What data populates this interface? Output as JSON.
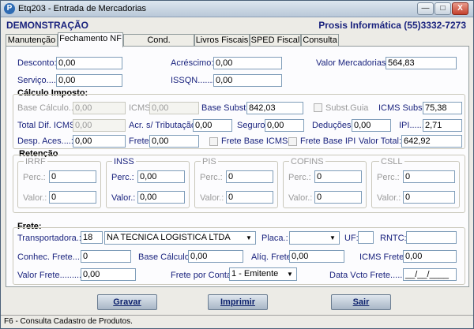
{
  "window": {
    "title": "Etq203 - Entrada de Mercadorias",
    "app_icon_letter": "P",
    "minimize_glyph": "—",
    "maximize_glyph": "□",
    "close_glyph": "X"
  },
  "header": {
    "left": "DEMONSTRAÇÃO",
    "right": "Prosis Informática (55)3332-7273"
  },
  "tabs": [
    {
      "label": "Manutenção"
    },
    {
      "label": "Fechamento NF",
      "active": true
    },
    {
      "label": "Cond. Pagamento"
    },
    {
      "label": "Livros Fiscais"
    },
    {
      "label": "SPED Fiscal"
    },
    {
      "label": "Consulta"
    }
  ],
  "top": {
    "desconto_label": "Desconto:",
    "desconto": "0,00",
    "acrescimo_label": "Acréscimo:",
    "acrescimo": "0,00",
    "valor_merc_label": "Valor Mercadorias:",
    "valor_merc": "564,83",
    "servico_label": "Serviço....:",
    "servico": "0,00",
    "issqn_label": "ISSQN........:",
    "issqn": "0,00"
  },
  "imposto": {
    "title": "Cálculo Imposto:",
    "base_calculo_label": "Base Cálculo....:",
    "base_calculo": "0,00",
    "icms_label": "ICMS:",
    "icms": "0,00",
    "base_subst_label": "Base Subst.",
    "base_subst": "842,03",
    "subst_guia_label": "Subst.Guia",
    "icms_subst_label": "ICMS Subst.",
    "icms_subst": "75,38",
    "total_dif_label": "Total Dif. ICMS:",
    "total_dif": "0,00",
    "acr_trib_label": "Acr. s/ Tributação:",
    "acr_trib": "0,00",
    "seguro_label": "Seguro:",
    "seguro": "0,00",
    "deducoes_label": "Deduções:",
    "deducoes": "0,00",
    "ipi_label": "IPI.......:",
    "ipi": "2,71",
    "desp_aces_label": "Desp. Aces....:",
    "desp_aces": "0,00",
    "frete_label": "Frete:",
    "frete": "0,00",
    "frete_base_icms_label": "Frete Base ICMS",
    "frete_base_ipi_label": "Frete Base IPI",
    "valor_total_label": "Valor Total:",
    "valor_total": "642,92"
  },
  "retencao": {
    "title": "Retenção",
    "groups": [
      {
        "name": "IRRF",
        "perc": "0",
        "valor": "0",
        "enabled": false
      },
      {
        "name": "INSS",
        "perc": "0,00",
        "valor": "0,00",
        "enabled": true
      },
      {
        "name": "PIS",
        "perc": "0",
        "valor": "0",
        "enabled": false
      },
      {
        "name": "COFINS",
        "perc": "0",
        "valor": "0",
        "enabled": false
      },
      {
        "name": "CSLL",
        "perc": "0",
        "valor": "0",
        "enabled": false
      }
    ],
    "perc_label": "Perc.:",
    "valor_label": "Valor.:"
  },
  "frete": {
    "title": "Frete:",
    "transportadora_label": "Transportadora.:",
    "transportadora_code": "18",
    "transportadora_name": "NA TECNICA LOGISTICA LTDA",
    "placa_label": "Placa.:",
    "placa": "",
    "uf_label": "UF:",
    "uf": "",
    "rntc_label": "RNTC:",
    "rntc": "",
    "conhec_label": "Conhec. Frete.....:",
    "conhec": "0",
    "base_calc_label": "Base Cálculo.",
    "base_calc": "0,00",
    "aliq_label": "Alíq. Frete:",
    "aliq": "0,00",
    "icms_frete_label": "ICMS Frete.:",
    "icms_frete": "0,00",
    "valor_frete_label": "Valor Frete.........:",
    "valor_frete": "0,00",
    "por_conta_label": "Frete por Conta.:",
    "por_conta": "1 - Emitente",
    "data_vcto_label": "Data Vcto Frete.......:",
    "data_vcto": "__/__/____"
  },
  "buttons": {
    "gravar": "Gravar",
    "imprimir": "Imprimir",
    "sair": "Sair"
  },
  "status": "F6 - Consulta Cadastro de Produtos."
}
